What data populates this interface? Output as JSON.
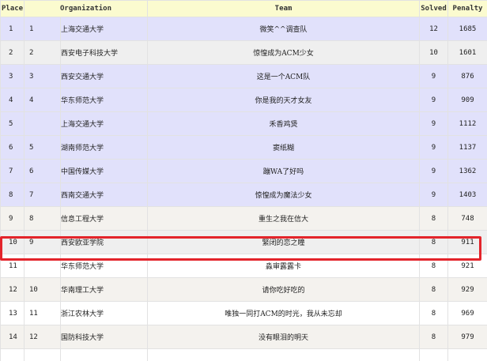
{
  "headers": {
    "place": "Place",
    "organization": "Organization",
    "team": "Team",
    "solved": "Solved",
    "penalty": "Penalty"
  },
  "rows": [
    {
      "place": "1",
      "rank": "1",
      "org": "上海交通大学",
      "team": "微笑^^调查队",
      "solved": "12",
      "penalty": "1685",
      "medal": "gold"
    },
    {
      "place": "2",
      "rank": "2",
      "org": "西安电子科技大学",
      "team": "惊惶成为ACM少女",
      "solved": "10",
      "penalty": "1601",
      "medal": "silver"
    },
    {
      "place": "3",
      "rank": "3",
      "org": "西安交通大学",
      "team": "这是一个ACM队",
      "solved": "9",
      "penalty": "876",
      "medal": "gold"
    },
    {
      "place": "4",
      "rank": "4",
      "org": "华东师范大学",
      "team": "你是我的天才女友",
      "solved": "9",
      "penalty": "909",
      "medal": "gold"
    },
    {
      "place": "5",
      "rank": "",
      "org": "上海交通大学",
      "team": "禾香鸡煲",
      "solved": "9",
      "penalty": "1112",
      "medal": "gold"
    },
    {
      "place": "6",
      "rank": "5",
      "org": "湖南师范大学",
      "team": "窦纸糊",
      "solved": "9",
      "penalty": "1137",
      "medal": "gold"
    },
    {
      "place": "7",
      "rank": "6",
      "org": "中国传媒大学",
      "team": "蹦WA了好吗",
      "solved": "9",
      "penalty": "1362",
      "medal": "gold"
    },
    {
      "place": "8",
      "rank": "7",
      "org": "西南交通大学",
      "team": "惊惶成为魔法少女",
      "solved": "9",
      "penalty": "1403",
      "medal": "gold"
    },
    {
      "place": "9",
      "rank": "8",
      "org": "信息工程大学",
      "team": "重生之我在信大",
      "solved": "8",
      "penalty": "748",
      "medal": "bronze"
    },
    {
      "place": "10",
      "rank": "9",
      "org": "西安欧亚学院",
      "team": "緊闭的恋之瞳",
      "solved": "8",
      "penalty": "911",
      "medal": "silver"
    },
    {
      "place": "11",
      "rank": "",
      "org": "华东师范大学",
      "team": "淼审露露卡",
      "solved": "8",
      "penalty": "921",
      "medal": "plain"
    },
    {
      "place": "12",
      "rank": "10",
      "org": "华南理工大学",
      "team": "请你吃好吃的",
      "solved": "8",
      "penalty": "929",
      "medal": "bronze"
    },
    {
      "place": "13",
      "rank": "11",
      "org": "浙江农林大学",
      "team": "唯独一同打ACM的时光，我从未忘却",
      "solved": "8",
      "penalty": "969",
      "medal": "plain"
    },
    {
      "place": "14",
      "rank": "12",
      "org": "国防科技大学",
      "team": "没有眼泪的明天",
      "solved": "8",
      "penalty": "979",
      "medal": "bronze"
    },
    {
      "place": "",
      "rank": "",
      "org": "",
      "team": "",
      "solved": "",
      "penalty": "",
      "medal": "plain"
    }
  ],
  "highlight": {
    "color": "#e3242b",
    "row_place": "10"
  },
  "colors": {
    "header_bg": "#fbfbcf",
    "gold_bg": "#e1e1fb",
    "silver_bg": "#efefef",
    "bronze_bg": "#f4f2ee"
  }
}
